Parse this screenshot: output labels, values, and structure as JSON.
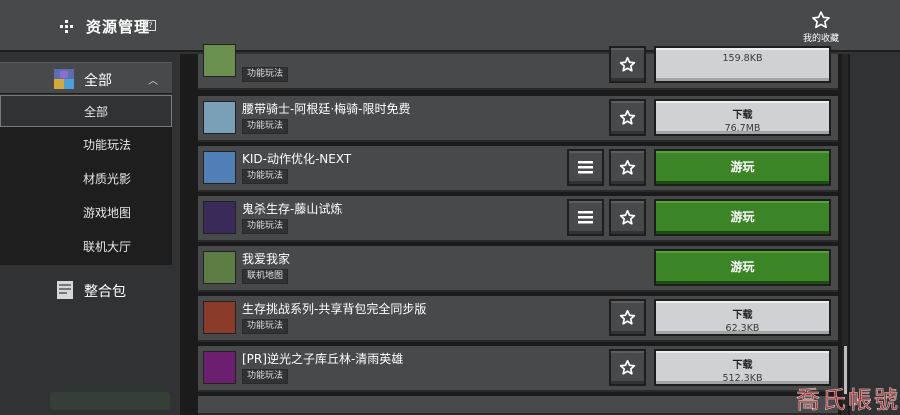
{
  "header": {
    "title": "资源管理",
    "help_label": "?",
    "favorites_label": "我的收藏"
  },
  "sidebar": {
    "category_head": "全部",
    "sub_items": [
      {
        "label": "全部",
        "selected": true
      },
      {
        "label": "功能玩法",
        "selected": false
      },
      {
        "label": "材质光影",
        "selected": false
      },
      {
        "label": "游戏地图",
        "selected": false
      },
      {
        "label": "联机大厅",
        "selected": false
      }
    ],
    "pack_label": "整合包"
  },
  "rows": [
    {
      "name": "",
      "tag": "功能玩法",
      "has_list_btn": false,
      "has_star": true,
      "action": "download",
      "action_label": "",
      "size": "159.8KB",
      "thumb": "#6a8f4e"
    },
    {
      "name": "腰带骑士-阿根廷·梅骑-限时免费",
      "tag": "功能玩法",
      "has_list_btn": false,
      "has_star": true,
      "action": "download",
      "action_label": "下载",
      "size": "76.7MB",
      "thumb": "#7aa0b8"
    },
    {
      "name": "KID-动作优化-NEXT",
      "tag": "功能玩法",
      "has_list_btn": true,
      "has_star": true,
      "action": "play",
      "action_label": "游玩",
      "size": "",
      "thumb": "#4f7fb5"
    },
    {
      "name": "鬼杀生存-藤山试炼",
      "tag": "功能玩法",
      "has_list_btn": true,
      "has_star": true,
      "action": "play",
      "action_label": "游玩",
      "size": "",
      "thumb": "#3a2a5a"
    },
    {
      "name": "我爱我家",
      "tag": "联机地图",
      "has_list_btn": false,
      "has_star": false,
      "action": "play",
      "action_label": "游玩",
      "size": "",
      "thumb": "#5d7d45"
    },
    {
      "name": "生存挑战系列-共享背包完全同步版",
      "tag": "功能玩法",
      "has_list_btn": false,
      "has_star": true,
      "action": "download",
      "action_label": "下载",
      "size": "62.3KB",
      "thumb": "#8a3b2a"
    },
    {
      "name": "[PR]逆光之子库丘林-清雨英雄",
      "tag": "功能玩法",
      "has_list_btn": false,
      "has_star": true,
      "action": "download",
      "action_label": "下载",
      "size": "512.3KB",
      "thumb": "#6b1f6e"
    }
  ],
  "watermark": "喬氏帳號",
  "colors": {
    "play_green": "#3c8527",
    "download_gray": "#d0d1d4",
    "panel": "#48494a",
    "background": "#313233"
  },
  "icons": [
    "back-dots-icon",
    "star-icon",
    "list-icon",
    "caret-up-icon",
    "category-grid-icon",
    "pack-icon"
  ]
}
